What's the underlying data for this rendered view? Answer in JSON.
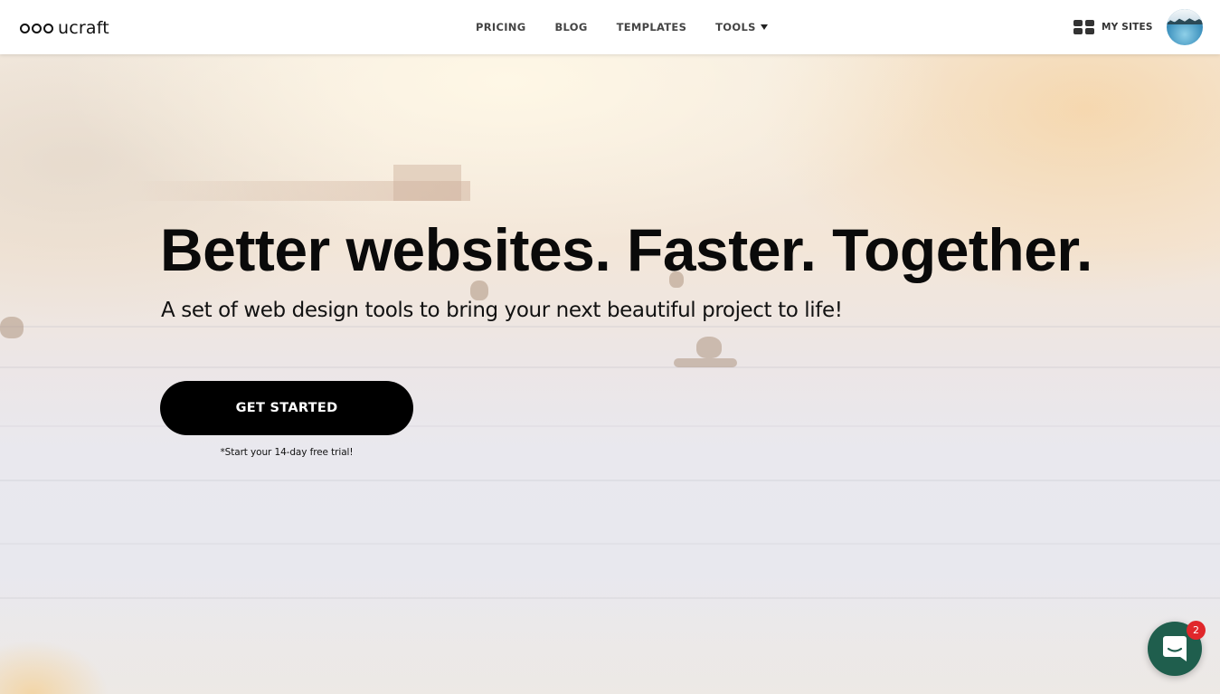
{
  "header": {
    "logo_text": "ucraft",
    "nav": [
      {
        "label": "PRICING"
      },
      {
        "label": "BLOG"
      },
      {
        "label": "TEMPLATES"
      },
      {
        "label": "TOOLS",
        "has_dropdown": true
      }
    ],
    "my_sites_label": "MY SITES",
    "my_sites_icon": "grid-icon",
    "avatar_icon": "user-avatar"
  },
  "hero": {
    "headline": "Better websites. Faster. Together.",
    "subheadline": "A set of web design tools to bring your next beautiful project to life!",
    "cta_label": "GET STARTED",
    "trial_note": "*Start your 14-day free trial!"
  },
  "chat": {
    "icon": "chat-bubble-icon",
    "badge_count": "2"
  },
  "colors": {
    "cta_background": "#000000",
    "chat_background": "#1f5e4d",
    "badge": "#e0272b"
  }
}
